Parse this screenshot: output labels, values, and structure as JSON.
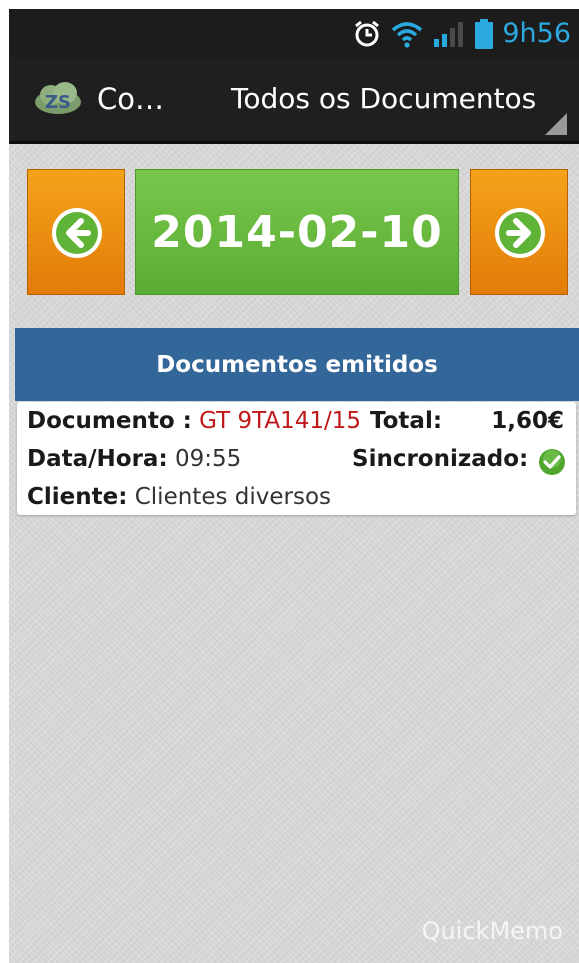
{
  "status_bar": {
    "time": "9h56",
    "icons": [
      "alarm-icon",
      "wifi-icon",
      "signal-icon",
      "battery-icon"
    ],
    "accent_color": "#2ba9df"
  },
  "action_bar": {
    "app_title": "Co…",
    "app_logo_text": "ZS",
    "filter_label": "Todos os Documentos"
  },
  "date_nav": {
    "date": "2014-02-10",
    "prev_icon": "arrow-left-circle-icon",
    "next_icon": "arrow-right-circle-icon",
    "nav_color": "#f0941a",
    "date_color": "#6cbb45"
  },
  "documents": {
    "header": "Documentos emitidos",
    "header_color": "#336699",
    "items": [
      {
        "documento_label": "Documento :",
        "documento_value": "GT 9TA141/15",
        "total_label": "Total:",
        "total_value": "1,60€",
        "datahora_label": "Data/Hora:",
        "datahora_value": "09:55",
        "sincronizado_label": "Sincronizado:",
        "sincronizado_icon": "check-circle-icon",
        "cliente_label": "Cliente:",
        "cliente_value": "Clientes diversos"
      }
    ]
  },
  "watermark": "QuickMemo"
}
